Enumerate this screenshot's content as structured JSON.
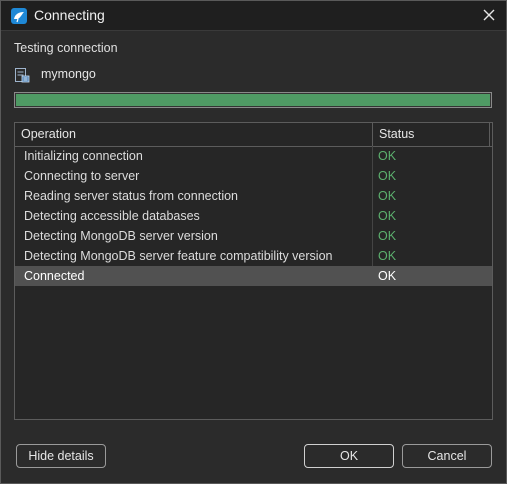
{
  "window": {
    "title": "Connecting",
    "icon": "mongodb-leaf-app-icon"
  },
  "header": {
    "subtitle": "Testing connection",
    "server_name": "mymongo",
    "server_icon": "server-document-icon"
  },
  "progress": {
    "value": 1.0
  },
  "table": {
    "columns": [
      "Operation",
      "Status"
    ],
    "rows": [
      {
        "operation": "Initializing connection",
        "status": "OK"
      },
      {
        "operation": "Connecting to server",
        "status": "OK"
      },
      {
        "operation": "Reading server status from connection",
        "status": "OK"
      },
      {
        "operation": "Detecting accessible databases",
        "status": "OK"
      },
      {
        "operation": "Detecting MongoDB server version",
        "status": "OK"
      },
      {
        "operation": "Detecting MongoDB server feature compatibility version",
        "status": "OK"
      },
      {
        "operation": "Connected",
        "status": "OK",
        "selected": true
      }
    ]
  },
  "buttons": {
    "hide_details": "Hide details",
    "ok": "OK",
    "cancel": "Cancel"
  },
  "colors": {
    "progress_fill": "#4f9a64",
    "status_ok": "#5cb06e",
    "selected_row": "#515151"
  }
}
